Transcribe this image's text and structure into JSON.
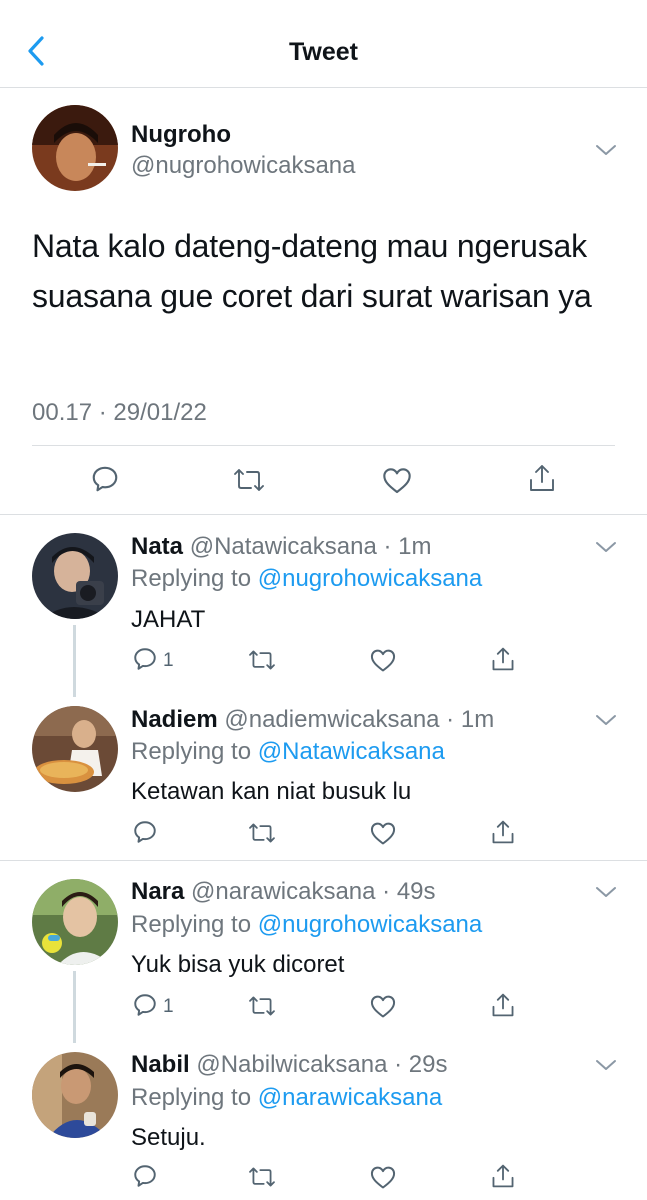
{
  "header": {
    "title": "Tweet",
    "back_icon": "back-chevron-icon",
    "accent": "#1d9bf0"
  },
  "main_tweet": {
    "name": "Nugroho",
    "handle": "@nugrohowicaksana",
    "text": "Nata kalo dateng-dateng mau ngerusak suasana gue coret dari surat warisan ya",
    "time": "00.17 · 29/01/22",
    "actions": [
      "reply-icon",
      "retweet-icon",
      "like-icon",
      "share-icon"
    ]
  },
  "replies": [
    {
      "name": "Nata",
      "handle": "@Natawicaksana",
      "time": "1m",
      "replying_label": "Replying to ",
      "replying_to": "@nugrohowicaksana",
      "text": "JAHAT",
      "reply_count": "1"
    },
    {
      "name": "Nadiem",
      "handle": "@nadiemwicaksana",
      "time": "1m",
      "replying_label": "Replying to ",
      "replying_to": "@Natawicaksana",
      "text": "Ketawan kan niat busuk lu",
      "reply_count": ""
    },
    {
      "name": "Nara",
      "handle": "@narawicaksana",
      "time": "49s",
      "replying_label": "Replying to ",
      "replying_to": "@nugrohowicaksana",
      "text": "Yuk bisa yuk dicoret",
      "reply_count": "1"
    },
    {
      "name": "Nabil",
      "handle": "@Nabilwicaksana",
      "time": "29s",
      "replying_label": "Replying to ",
      "replying_to": "@narawicaksana",
      "text": "Setuju.",
      "reply_count": ""
    }
  ],
  "separator": " · ",
  "colors": {
    "text": "#0f1419",
    "secondary": "#6e767d",
    "link": "#1d9bf0",
    "divider": "#dcdfe2"
  }
}
